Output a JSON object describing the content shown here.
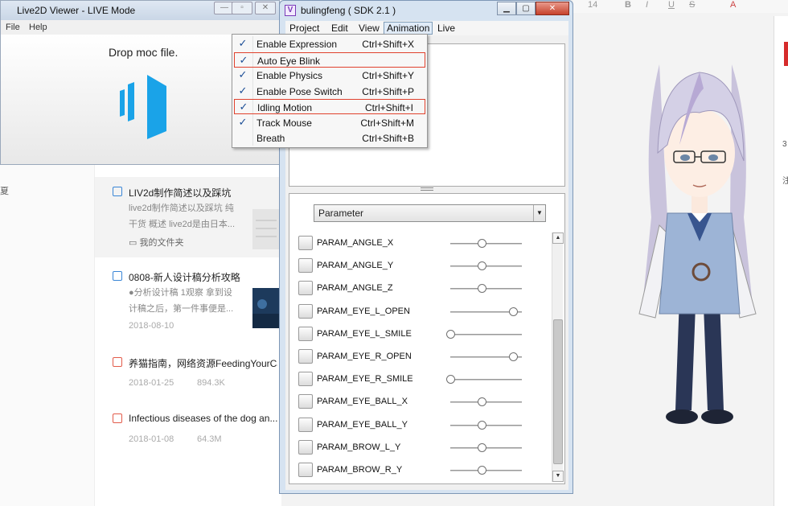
{
  "viewer": {
    "title": "Live2D Viewer - LIVE Mode",
    "menu": [
      "File",
      "Help"
    ],
    "drop_text": "Drop moc file."
  },
  "sdk": {
    "title": "bulingfeng ( SDK 2.1 )",
    "menu": [
      "Project",
      "Edit",
      "View",
      "Animation",
      "Live"
    ],
    "param_select": "Parameter",
    "params": [
      {
        "label": "PARAM_ANGLE_X",
        "value": 0.5
      },
      {
        "label": "PARAM_ANGLE_Y",
        "value": 0.5
      },
      {
        "label": "PARAM_ANGLE_Z",
        "value": 0.5
      },
      {
        "label": "PARAM_EYE_L_OPEN",
        "value": 1.0
      },
      {
        "label": "PARAM_EYE_L_SMILE",
        "value": 0.0
      },
      {
        "label": "PARAM_EYE_R_OPEN",
        "value": 1.0
      },
      {
        "label": "PARAM_EYE_R_SMILE",
        "value": 0.0
      },
      {
        "label": "PARAM_EYE_BALL_X",
        "value": 0.5
      },
      {
        "label": "PARAM_EYE_BALL_Y",
        "value": 0.5
      },
      {
        "label": "PARAM_BROW_L_Y",
        "value": 0.5
      },
      {
        "label": "PARAM_BROW_R_Y",
        "value": 0.5
      }
    ]
  },
  "animation_menu": {
    "items": [
      {
        "label": "Enable Expression",
        "shortcut": "Ctrl+Shift+X",
        "checked": true,
        "highlighted": false
      },
      {
        "label": "Auto Eye Blink",
        "shortcut": "",
        "checked": true,
        "highlighted": true
      },
      {
        "label": "Enable Physics",
        "shortcut": "Ctrl+Shift+Y",
        "checked": true,
        "highlighted": false
      },
      {
        "label": "Enable Pose Switch",
        "shortcut": "Ctrl+Shift+P",
        "checked": true,
        "highlighted": false
      },
      {
        "label": "Idling Motion",
        "shortcut": "Ctrl+Shift+I",
        "checked": true,
        "highlighted": true
      },
      {
        "label": "Track Mouse",
        "shortcut": "Ctrl+Shift+M",
        "checked": true,
        "highlighted": false
      },
      {
        "label": "Breath",
        "shortcut": "Ctrl+Shift+B",
        "checked": false,
        "highlighted": false
      }
    ]
  },
  "doc_list": {
    "left_fragment": "夏",
    "items": [
      {
        "title": "LIV2d制作简述以及踩坑",
        "sub1": "live2d制作简述以及踩坑 纯",
        "sub2": "干货 概述 live2d是由日本...",
        "folder": "我的文件夹",
        "date": "",
        "size": "",
        "icon": "doc"
      },
      {
        "title": "0808-新人设计稿分析攻略",
        "sub1": "●分析设计稿 1观察 拿到设",
        "sub2": "计稿之后，第一件事便是...",
        "folder": "",
        "date": "2018-08-10",
        "size": "",
        "icon": "doc"
      },
      {
        "title": "养猫指南，网络资源FeedingYourCat...",
        "sub1": "",
        "sub2": "",
        "folder": "",
        "date": "2018-01-25",
        "size": "894.3K",
        "icon": "pdf"
      },
      {
        "title": "Infectious diseases of the dog an...",
        "sub1": "",
        "sub2": "",
        "folder": "",
        "date": "2018-01-08",
        "size": "64.3M",
        "icon": "pdf"
      }
    ]
  },
  "right_app": {
    "font_size": "14",
    "bold": "B",
    "italic": "I",
    "underline": "U",
    "strike": "S",
    "font_color": "A",
    "frag1": "3",
    "frag2": "注"
  }
}
